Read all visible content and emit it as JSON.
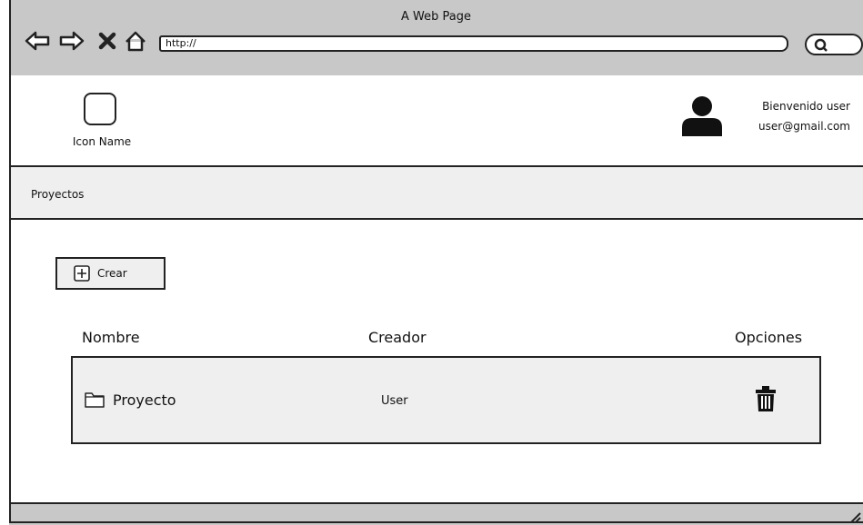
{
  "window": {
    "title": "A Web Page"
  },
  "browser": {
    "url": "http://"
  },
  "header": {
    "logo_label": "Icon Name",
    "greeting": "Bienvenido user",
    "email": "user@gmail.com"
  },
  "breadcrumb": {
    "label": "Proyectos"
  },
  "toolbar": {
    "create_label": "Crear"
  },
  "table": {
    "columns": [
      "Nombre",
      "Creador",
      "Opciones"
    ],
    "rows": [
      {
        "name": "Proyecto",
        "creator": "User"
      }
    ]
  },
  "icons": {
    "back": "arrow-left-icon",
    "forward": "arrow-right-icon",
    "stop": "close-icon",
    "home": "home-icon",
    "search": "search-icon",
    "logo": "placeholder-square-icon",
    "avatar": "user-icon",
    "create": "plus-square-icon",
    "folder": "folder-icon",
    "delete": "trash-icon"
  }
}
